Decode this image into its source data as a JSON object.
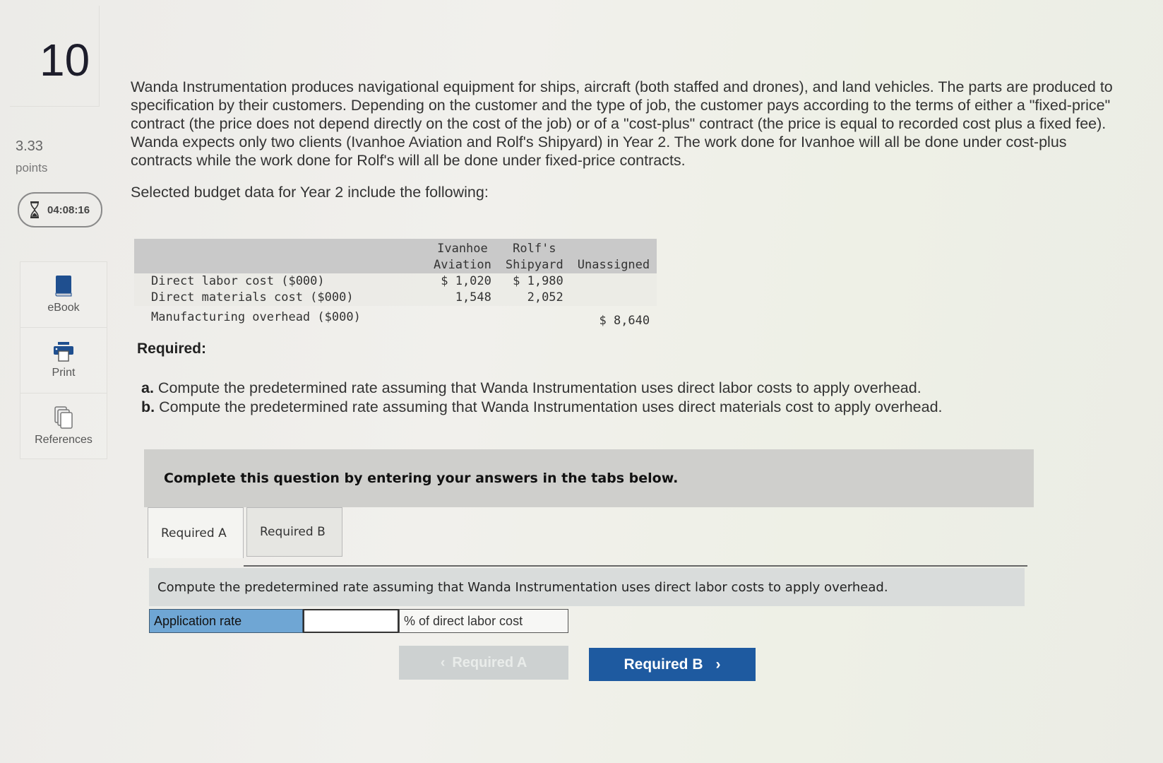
{
  "question": {
    "number": "10",
    "points_value": "3.33",
    "points_label": "points",
    "timer": "04:08:16"
  },
  "tools": [
    {
      "label": "eBook",
      "icon": "book-icon"
    },
    {
      "label": "Print",
      "icon": "printer-icon"
    },
    {
      "label": "References",
      "icon": "documents-icon"
    }
  ],
  "problem": {
    "intro": "Wanda Instrumentation produces navigational equipment for ships, aircraft (both staffed and drones), and land vehicles. The parts are produced to specification by their customers. Depending on the customer and the type of job, the customer pays according to the terms of either a \"fixed-price\" contract (the price does not depend directly on the cost of the job) or of a \"cost-plus\" contract (the price is equal to recorded cost plus a fixed fee). Wanda expects only two clients (Ivanhoe Aviation and Rolf's Shipyard) in Year 2. The work done for Ivanhoe will all be done under cost-plus contracts while the work done for Rolf's will all be done under fixed-price contracts.",
    "sub": "Selected budget data for Year 2 include the following:"
  },
  "budget_table": {
    "headers": [
      "",
      "Ivanhoe\nAviation",
      "Rolf's\nShipyard",
      "Unassigned"
    ],
    "rows": [
      {
        "label": "Direct labor cost ($000)",
        "ivanhoe": "$ 1,020",
        "rolfs": "$ 1,980",
        "unassigned": ""
      },
      {
        "label": "Direct materials cost ($000)",
        "ivanhoe": "1,548",
        "rolfs": "2,052",
        "unassigned": ""
      },
      {
        "label": "Manufacturing overhead ($000)",
        "ivanhoe": "",
        "rolfs": "",
        "unassigned": "$ 8,640"
      }
    ]
  },
  "required": {
    "heading": "Required:",
    "items": [
      {
        "marker": "a.",
        "text": "Compute the predetermined rate assuming that Wanda Instrumentation uses direct labor costs to apply overhead."
      },
      {
        "marker": "b.",
        "text": "Compute the predetermined rate assuming that Wanda Instrumentation uses direct materials cost to apply overhead."
      }
    ]
  },
  "banner": "Complete this question by entering your answers in the tabs below.",
  "tabs": [
    {
      "label": "Required A",
      "active": true
    },
    {
      "label": "Required B",
      "active": false
    }
  ],
  "instruction": "Compute the predetermined rate assuming that Wanda Instrumentation uses direct labor costs to apply overhead.",
  "answer": {
    "label": "Application rate",
    "value": "",
    "unit": "% of direct labor cost"
  },
  "nav": {
    "prev_label": "Required A",
    "next_label": "Required B"
  },
  "colors": {
    "accent": "#1e5aa0",
    "answer_label_bg": "#6fa6d4",
    "icon_blue": "#1f4f8f"
  }
}
